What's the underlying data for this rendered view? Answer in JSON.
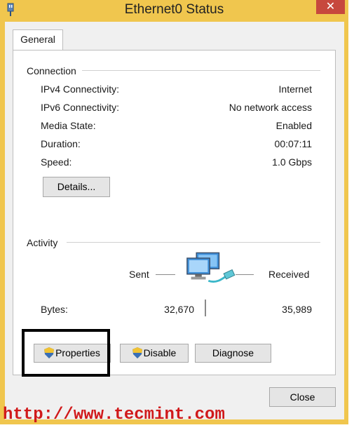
{
  "window": {
    "title": "Ethernet0 Status",
    "close_label": "✕",
    "accent_color": "#f0c64e",
    "icon": "network-adapter-icon"
  },
  "tabs": [
    {
      "label": "General"
    }
  ],
  "connection": {
    "group_label": "Connection",
    "rows": [
      {
        "label": "IPv4 Connectivity:",
        "value": "Internet"
      },
      {
        "label": "IPv6 Connectivity:",
        "value": "No network access"
      },
      {
        "label": "Media State:",
        "value": "Enabled"
      },
      {
        "label": "Duration:",
        "value": "00:07:11"
      },
      {
        "label": "Speed:",
        "value": "1.0 Gbps"
      }
    ],
    "details_button": "Details..."
  },
  "activity": {
    "group_label": "Activity",
    "sent_label": "Sent",
    "received_label": "Received",
    "bytes_label": "Bytes:",
    "bytes_sent": "32,670",
    "bytes_received": "35,989",
    "icon": "network-computers-icon"
  },
  "buttons": {
    "properties": "Properties",
    "disable": "Disable",
    "diagnose": "Diagnose",
    "close": "Close",
    "shield_icon": "uac-shield-icon"
  },
  "watermark": "http://www.tecmint.com"
}
